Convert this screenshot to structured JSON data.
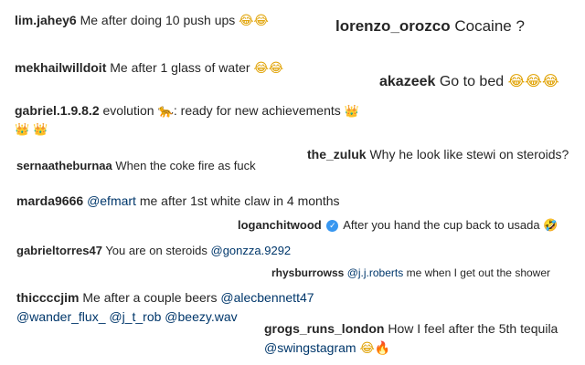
{
  "comments": [
    {
      "user": "lim.jahey6",
      "text": "Me after doing 10 push ups",
      "emoji": "😂😂"
    },
    {
      "user": "lorenzo_orozco",
      "text": "Cocaine ?"
    },
    {
      "user": "mekhailwilldoit",
      "text": "Me after 1 glass of water",
      "emoji": "😂😂"
    },
    {
      "user": "akazeek",
      "text": "Go to bed",
      "emoji": "😂😂😂"
    },
    {
      "user": "gabriel.1.9.8.2",
      "text_a": "evolution",
      "emoji_a": "🐆",
      "text_b": ": ready for new achievements",
      "emoji_b": "👑",
      "emoji_c": "👑 👑"
    },
    {
      "user": "the_zuluk",
      "text": "Why he look like stewi on steroids?"
    },
    {
      "user": "sernaatheburnaa",
      "text": "When the coke fire as fuck"
    },
    {
      "user": "marda9666",
      "mention": "@efmart",
      "text": "me after 1st white claw in 4 months"
    },
    {
      "user": "loganchitwood",
      "verified": "✓",
      "text": "After you hand the cup back to usada",
      "emoji": "🤣"
    },
    {
      "user": "gabrieltorres47",
      "text": "You are on steroids",
      "mention": "@gonzza.9292"
    },
    {
      "user": "rhysburrowss",
      "mention": "@j.j.roberts",
      "text": "me when I get out the shower"
    },
    {
      "user": "thiccccjim",
      "text": "Me after a couple beers",
      "mention": "@alecbennett47",
      "line2": "@wander_flux_ @j_t_rob @beezy.wav"
    },
    {
      "user": "grogs_runs_london",
      "text": "How I feel after the 5th tequila",
      "mention": "@swingstagram",
      "emoji": "😂",
      "emoji_b": "🔥"
    }
  ]
}
